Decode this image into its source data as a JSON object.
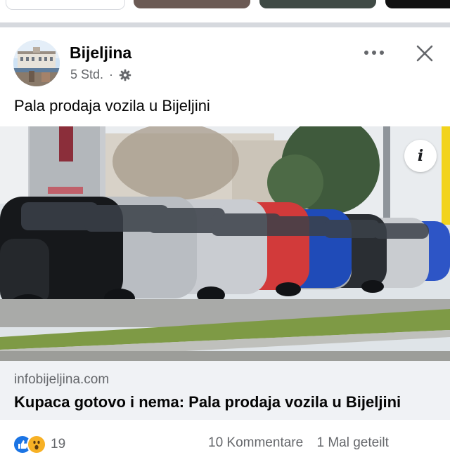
{
  "top_chips": {
    "colors": [
      "#eef0f3",
      "#6b5a54",
      "#3f4a45",
      "#111111"
    ]
  },
  "post": {
    "page_name": "Bijeljina",
    "time": "5 Std.",
    "separator": "·",
    "text": "Pala prodaja vozila u Bijeljini",
    "more_icon": "more-dots-icon",
    "close_icon": "close-icon",
    "privacy_icon": "gear-icon"
  },
  "image": {
    "info_label": "i"
  },
  "link_preview": {
    "domain": "infobijeljina.com",
    "title": "Kupaca gotovo i nema: Pala prodaja vozila u Bijeljini"
  },
  "footer": {
    "reaction_icons": [
      "like-icon",
      "wow-icon"
    ],
    "reaction_count": "19",
    "comments": "10 Kommentare",
    "shares": "1 Mal geteilt"
  },
  "colors": {
    "accent_blue": "#1b74e4",
    "wow_yellow": "#f7b125",
    "secondary_text": "#65676b",
    "link_bg": "#f0f2f5"
  }
}
